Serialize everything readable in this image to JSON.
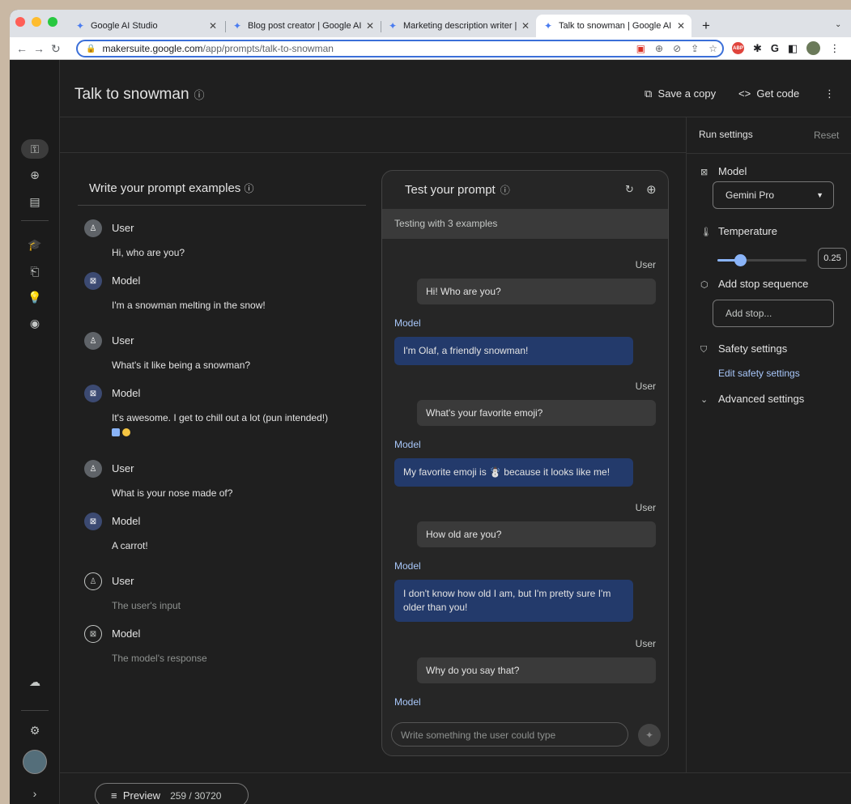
{
  "browser": {
    "tabs": [
      {
        "title": "Google AI Studio"
      },
      {
        "title": "Blog post creator | Google AI S"
      },
      {
        "title": "Marketing description writer | ("
      },
      {
        "title": "Talk to snowman | Google AI S"
      }
    ],
    "url_host": "makersuite.google.com",
    "url_path": "/app/prompts/talk-to-snowman"
  },
  "header": {
    "title": "Talk to snowman",
    "save_copy": "Save a copy",
    "get_code": "Get code"
  },
  "left": {
    "heading": "Write your prompt examples",
    "examples": [
      {
        "role": "User",
        "text": "Hi, who are you?"
      },
      {
        "role": "Model",
        "text": "I'm a snowman melting in the snow!"
      },
      {
        "role": "User",
        "text": "What's it like being a snowman?"
      },
      {
        "role": "Model",
        "text": "It's awesome. I get to chill out a lot (pun intended!)"
      },
      {
        "role": "User",
        "text": "What is your nose made of?"
      },
      {
        "role": "Model",
        "text": "A carrot!"
      },
      {
        "role": "User",
        "text": "The user's input"
      },
      {
        "role": "Model",
        "text": "The model's response"
      }
    ]
  },
  "test": {
    "heading": "Test your prompt",
    "strip": "Testing with 3 examples",
    "user_label": "User",
    "model_label": "Model",
    "messages": [
      {
        "user": "Hi! Who are you?",
        "model": "I'm Olaf, a friendly snowman!"
      },
      {
        "user": "What's your favorite emoji?",
        "model": "My favorite emoji is ☃️ because it looks like me!"
      },
      {
        "user": "How old are you?",
        "model": "I don't know how old I am, but I'm pretty sure I'm older than you!"
      },
      {
        "user": "Why do you say that?",
        "model": ""
      }
    ],
    "input_placeholder": "Write something the user could type"
  },
  "settings": {
    "heading": "Run settings",
    "reset": "Reset",
    "model_label": "Model",
    "model_value": "Gemini Pro",
    "temperature_label": "Temperature",
    "temperature_value": "0.25",
    "temperature_fraction": 0.25,
    "stop_label": "Add stop sequence",
    "stop_placeholder": "Add stop...",
    "safety_label": "Safety settings",
    "safety_link": "Edit safety settings",
    "advanced_label": "Advanced settings"
  },
  "footer": {
    "preview": "Preview",
    "count": "259 / 30720"
  },
  "colors": {
    "accent": "#8ab4f8",
    "model_bubble": "#233a6b"
  }
}
